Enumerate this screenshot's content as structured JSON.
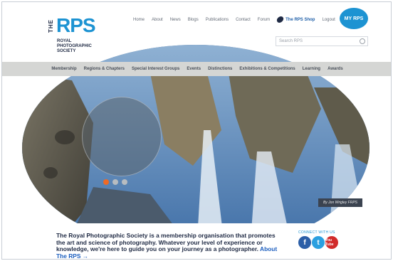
{
  "logo": {
    "the": "THE",
    "rps": "RPS",
    "sub": "ROYAL PHOTOGRAPHIC SOCIETY"
  },
  "topnav": {
    "items": [
      "Home",
      "About",
      "News",
      "Blogs",
      "Publications",
      "Contact",
      "Forum"
    ],
    "shop_label": "The RPS Shop",
    "logout_label": "Logout"
  },
  "myrps_label": "MY RPS",
  "search": {
    "placeholder": "Search RPS"
  },
  "mainnav": {
    "items": [
      "Membership",
      "Regions & Chapters",
      "Special Interest Groups",
      "Events",
      "Distinctions",
      "Exhibitions & Competitions",
      "Learning",
      "Awards"
    ]
  },
  "hero": {
    "credit": "By Jon Wrigley FRPS",
    "carousel": {
      "count": 3,
      "active": 1
    }
  },
  "intro": {
    "text": "The Royal Photographic Society is a membership organisation that promotes the art and science of photography. Whatever your level of experience or knowledge, we're here to guide you on your journey as a photographer.",
    "link": "About The RPS →"
  },
  "connect": {
    "label": "CONNECT WITH US",
    "youtube_label": "You Tube"
  },
  "colors": {
    "brand": "#1d93d2",
    "nav_bg": "#d5d6d4",
    "active_dot": "#f06a24"
  }
}
